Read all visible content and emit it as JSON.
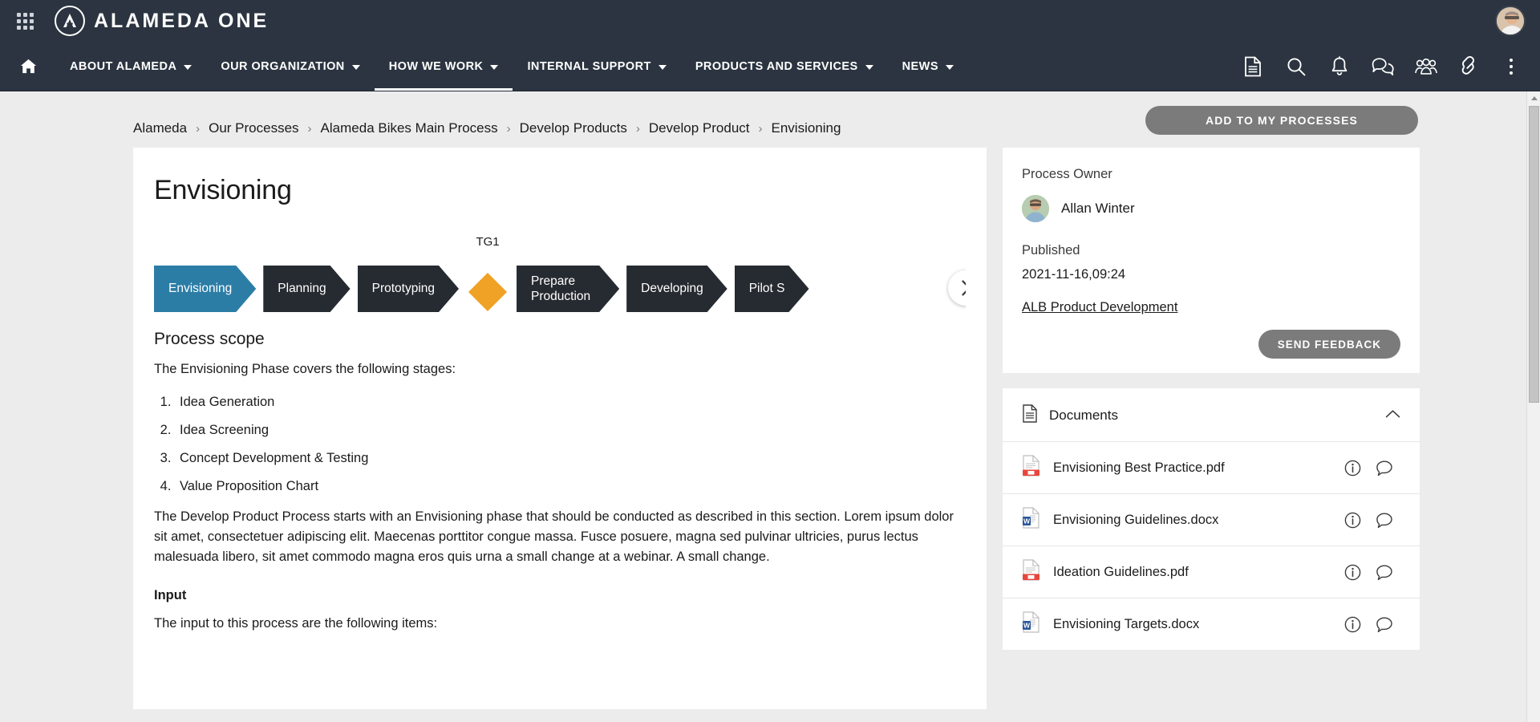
{
  "brand": {
    "app_name": "ALAMEDA ONE",
    "waffle_icon": "apps-grid-icon",
    "logo_icon": "alameda-logo-icon",
    "avatar_icon": "user-avatar"
  },
  "nav": {
    "home_icon": "home-icon",
    "items": [
      {
        "label": "ABOUT ALAMEDA",
        "has_caret": true,
        "active": false
      },
      {
        "label": "OUR ORGANIZATION",
        "has_caret": true,
        "active": false
      },
      {
        "label": "HOW WE WORK",
        "has_caret": true,
        "active": true
      },
      {
        "label": "INTERNAL SUPPORT",
        "has_caret": true,
        "active": false
      },
      {
        "label": "PRODUCTS AND SERVICES",
        "has_caret": true,
        "active": false
      },
      {
        "label": "NEWS",
        "has_caret": true,
        "active": false
      }
    ],
    "icons": [
      "document-icon",
      "search-icon",
      "bell-icon",
      "chat-icon",
      "people-icon",
      "link-icon",
      "kebab-menu-icon"
    ]
  },
  "breadcrumb": {
    "separator": "›",
    "items": [
      "Alameda",
      "Our Processes",
      "Alameda Bikes Main Process",
      "Develop Products",
      "Develop Product",
      "Envisioning"
    ]
  },
  "actions": {
    "add_to_my_processes": "ADD TO MY PROCESSES",
    "send_feedback": "SEND FEEDBACK"
  },
  "main": {
    "title": "Envisioning",
    "flow": {
      "gate_label": "TG1",
      "steps": [
        {
          "label": "Envisioning",
          "color": "#2c7da6",
          "active": true
        },
        {
          "label": "Planning",
          "color": "#262b31",
          "active": false
        },
        {
          "label": "Prototyping",
          "color": "#262b31",
          "active": false
        },
        {
          "label": "Prepare\nProduction",
          "color": "#262b31",
          "active": false
        },
        {
          "label": "Developing",
          "color": "#262b31",
          "active": false
        },
        {
          "label": "Pilot S",
          "color": "#262b31",
          "active": false
        }
      ],
      "gate_color": "#efa226",
      "scroll_next_icon": "chevron-right-icon"
    },
    "scope_heading": "Process scope",
    "scope_intro": "The Envisioning Phase covers the following stages:",
    "stages": [
      "Idea Generation",
      "Idea Screening",
      "Concept Development & Testing",
      "Value Proposition Chart"
    ],
    "description": "The Develop Product Process starts with an Envisioning phase that should be conducted as described in this section. Lorem ipsum dolor sit amet, consectetuer adipiscing elit. Maecenas porttitor congue massa. Fusce posuere, magna sed pulvinar ultricies, purus lectus malesuada libero, sit amet commodo magna eros quis urna a small change at a webinar. A small change.",
    "input_label": "Input",
    "input_intro": "The input to this process are the following items:"
  },
  "sidebar": {
    "owner_label": "Process Owner",
    "owner_name": "Allan Winter",
    "published_label": "Published",
    "published_value": "2021-11-16,09:24",
    "related_link": "ALB Product Development",
    "documents": {
      "title": "Documents",
      "icon": "document-icon",
      "collapse_icon": "chevron-up-icon",
      "info_icon": "info-icon",
      "comment_icon": "comment-icon",
      "items": [
        {
          "name": "Envisioning Best Practice.pdf",
          "type": "pdf"
        },
        {
          "name": "Envisioning Guidelines.docx",
          "type": "docx"
        },
        {
          "name": "Ideation Guidelines.pdf",
          "type": "pdf"
        },
        {
          "name": "Envisioning Targets.docx",
          "type": "docx"
        }
      ]
    }
  },
  "scrollbar": {
    "up_arrow_icon": "scroll-up-arrow-icon",
    "thumb": "scroll-thumb"
  },
  "colors": {
    "header_bg": "#2b3440",
    "accent_teal": "#2c7da6",
    "gate_orange": "#efa226",
    "step_dark": "#262b31",
    "button_grey": "#7b7b7b",
    "page_bg": "#ececed"
  }
}
